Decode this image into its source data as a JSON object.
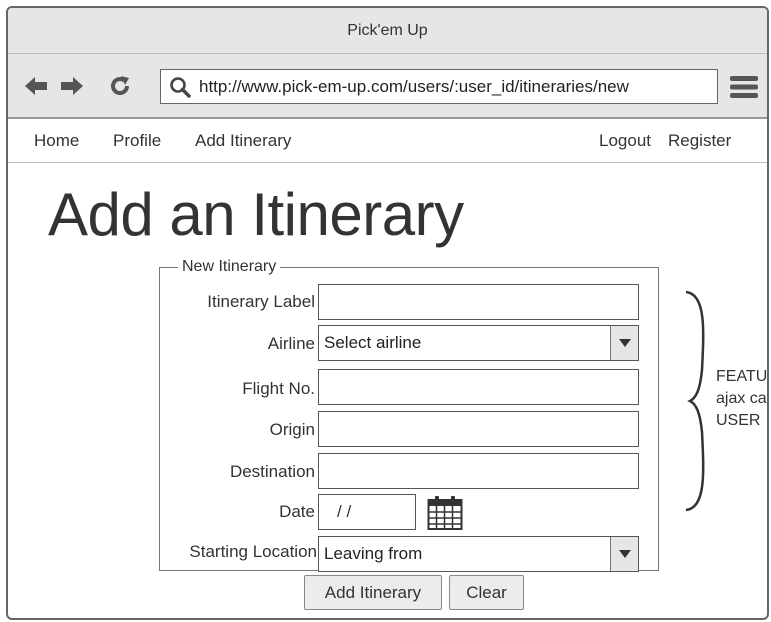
{
  "window": {
    "title": "Pick'em Up"
  },
  "toolbar": {
    "back_icon": "arrow-left-icon",
    "forward_icon": "arrow-right-icon",
    "reload_icon": "reload-icon",
    "url": "http://www.pick-em-up.com/users/:user_id/itineraries/new",
    "menu_icon": "hamburger-icon"
  },
  "nav": {
    "home": "Home",
    "profile": "Profile",
    "add_itinerary": "Add Itinerary",
    "logout": "Logout",
    "register": "Register"
  },
  "page": {
    "title": "Add an Itinerary"
  },
  "form": {
    "legend": "New Itinerary",
    "itinerary_label": {
      "label": "Itinerary Label",
      "value": ""
    },
    "airline": {
      "label": "Airline",
      "value": "Select airline"
    },
    "flight_no": {
      "label": "Flight No.",
      "value": ""
    },
    "origin": {
      "label": "Origin",
      "value": ""
    },
    "destination": {
      "label": "Destination",
      "value": ""
    },
    "date": {
      "label": "Date",
      "value": "/ /"
    },
    "starting_location": {
      "label": "Starting Location",
      "value": "Leaving from"
    },
    "submit_label": "Add Itinerary",
    "clear_label": "Clear"
  },
  "annotation": {
    "lines": [
      "FEATU",
      "ajax ca",
      "USER"
    ]
  },
  "colors": {
    "chrome": "#e6e6e6",
    "border": "#666666",
    "text": "#333333"
  }
}
